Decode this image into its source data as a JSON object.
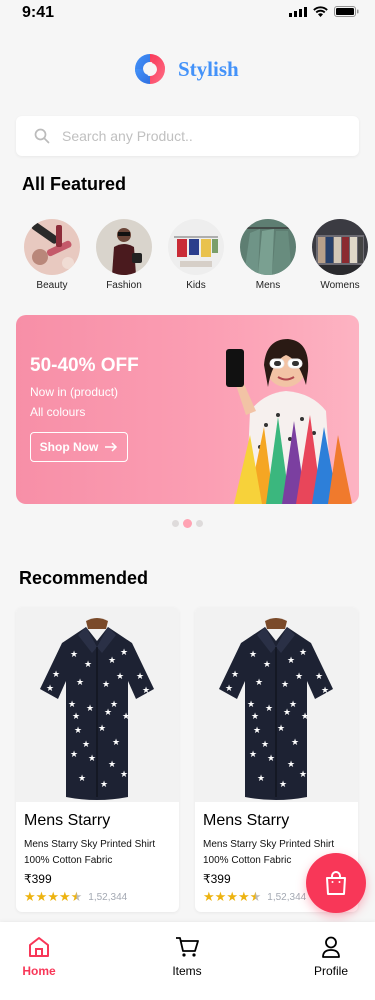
{
  "status_bar": {
    "time": "9:41"
  },
  "app": {
    "name": "Stylish"
  },
  "search": {
    "placeholder": "Search any Product.."
  },
  "featured": {
    "title": "All Featured",
    "categories": [
      {
        "label": "Beauty"
      },
      {
        "label": "Fashion"
      },
      {
        "label": "Kids"
      },
      {
        "label": "Mens"
      },
      {
        "label": "Womens"
      }
    ]
  },
  "banner": {
    "title": "50-40% OFF",
    "subtitle1": "Now in (product)",
    "subtitle2": "All colours",
    "cta": "Shop Now",
    "active_dot": 1
  },
  "recommended": {
    "title": "Recommended",
    "products": [
      {
        "title": "Mens Starry",
        "desc1": "Mens Starry Sky Printed Shirt",
        "desc2": "100% Cotton Fabric",
        "price": "₹399",
        "rating": 4.5,
        "reviews": "1,52,344"
      },
      {
        "title": "Mens Starry",
        "desc1": "Mens Starry Sky Printed Shirt",
        "desc2": "100% Cotton Fabric",
        "price": "₹399",
        "rating": 4.5,
        "reviews": "1,52,344"
      }
    ]
  },
  "bottom_nav": {
    "items": [
      {
        "label": "Home",
        "icon": "home-icon",
        "active": true
      },
      {
        "label": "Items",
        "icon": "cart-icon",
        "active": false
      },
      {
        "label": "Profile",
        "icon": "user-icon",
        "active": false
      }
    ]
  },
  "colors": {
    "accent": "#F83758",
    "brand": "#4392F9",
    "star": "#EDB310"
  }
}
